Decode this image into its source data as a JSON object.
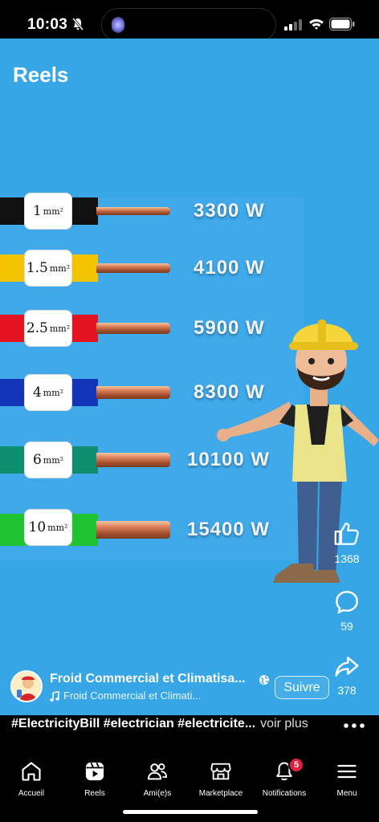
{
  "status_bar": {
    "time": "10:03"
  },
  "header": {
    "title": "Reels"
  },
  "wires": [
    {
      "size": "1",
      "unit": "mm²",
      "power": "3300 W",
      "color": "#111111"
    },
    {
      "size": "1.5",
      "unit": "mm²",
      "power": "4100 W",
      "color": "#f5c400"
    },
    {
      "size": "2.5",
      "unit": "mm²",
      "power": "5900 W",
      "color": "#e3141f"
    },
    {
      "size": "4",
      "unit": "mm²",
      "power": "8300 W",
      "color": "#1336b8"
    },
    {
      "size": "6",
      "unit": "mm²",
      "power": "10100 W",
      "color": "#0f8f6f"
    },
    {
      "size": "10",
      "unit": "mm²",
      "power": "15400 W",
      "color": "#20c433"
    }
  ],
  "actions": {
    "like_count": "1368",
    "comment_count": "59",
    "share_count": "378"
  },
  "author": {
    "name": "Froid Commercial et Climatisa...",
    "audio": "Froid Commercial et Climati...",
    "follow_label": "Suivre"
  },
  "caption": {
    "text": "#ElectricityBill #electrician #electricite...",
    "see_more": "voir plus"
  },
  "tabs": [
    {
      "label": "Accueil",
      "icon": "home-icon"
    },
    {
      "label": "Reels",
      "icon": "reels-icon"
    },
    {
      "label": "Ami(e)s",
      "icon": "friends-icon"
    },
    {
      "label": "Marketplace",
      "icon": "marketplace-icon"
    },
    {
      "label": "Notifications",
      "icon": "bell-icon",
      "badge": "5"
    },
    {
      "label": "Menu",
      "icon": "menu-icon"
    }
  ],
  "colors": {
    "reel_background": "#36a6e6",
    "badge": "#e41e3f"
  }
}
